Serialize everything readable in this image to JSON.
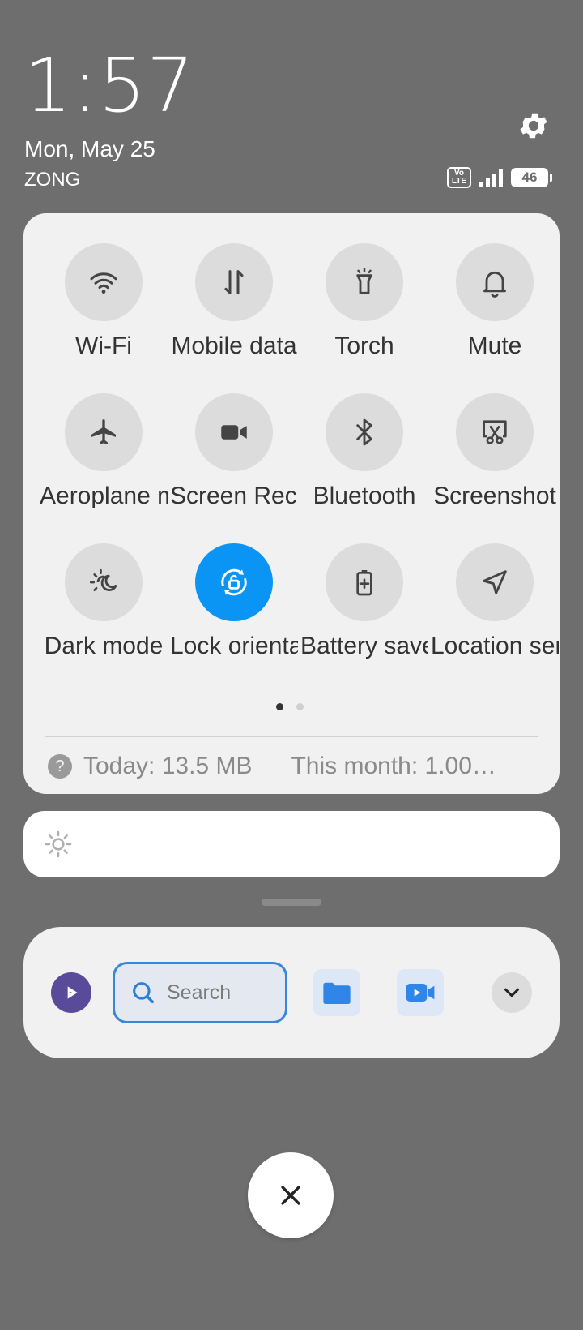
{
  "status": {
    "time": "1:57",
    "date": "Mon, May 25",
    "carrier": "ZONG",
    "volte_label": "Vo\nLTE",
    "battery_level": "46"
  },
  "quick_settings": {
    "tiles": [
      {
        "label": "Wi-Fi",
        "icon": "wifi-icon",
        "active": false
      },
      {
        "label": "Mobile data",
        "icon": "mobile-data-icon",
        "active": false
      },
      {
        "label": "Torch",
        "icon": "torch-icon",
        "active": false
      },
      {
        "label": "Mute",
        "icon": "bell-icon",
        "active": false
      },
      {
        "label": "Aeroplane mode",
        "icon": "airplane-icon",
        "active": false
      },
      {
        "label": "Screen Recorder",
        "icon": "video-camera-icon",
        "active": false
      },
      {
        "label": "Bluetooth",
        "icon": "bluetooth-icon",
        "active": false
      },
      {
        "label": "Screenshot",
        "icon": "screenshot-icon",
        "active": false
      },
      {
        "label": "Dark mode",
        "icon": "dark-mode-icon",
        "active": false
      },
      {
        "label": "Lock orientation",
        "icon": "lock-rotation-icon",
        "active": true
      },
      {
        "label": "Battery saver",
        "icon": "battery-saver-icon",
        "active": false
      },
      {
        "label": "Location services",
        "icon": "location-icon",
        "active": false
      }
    ],
    "page_count": 2,
    "current_page": 1
  },
  "data_usage": {
    "today": "Today: 13.5 MB",
    "month": "This month: 1.00…"
  },
  "brightness": {
    "icon": "sun-icon"
  },
  "dock": {
    "search_placeholder": "Search",
    "items": [
      "app-logo-icon",
      "search-icon",
      "folder-icon",
      "video-icon",
      "chevron-down-icon"
    ]
  },
  "colors": {
    "accent": "#0a95f5",
    "background": "#6e6e6e",
    "panel": "#f1f1f1"
  }
}
